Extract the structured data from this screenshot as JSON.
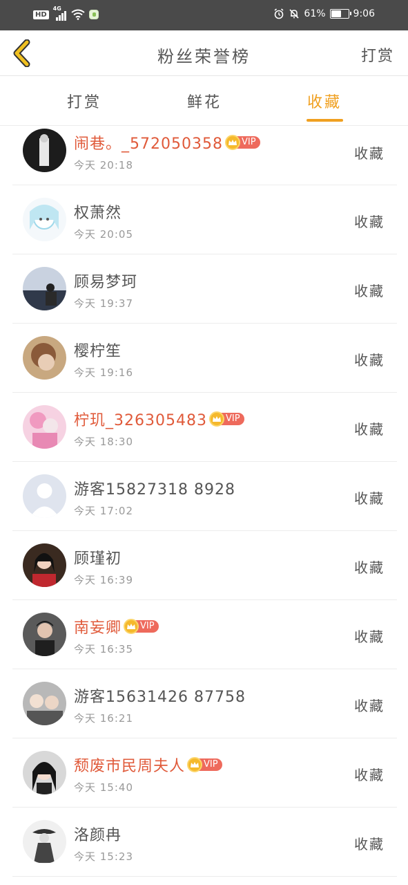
{
  "status_bar": {
    "hd": "HD",
    "network": "4G",
    "battery_text": "61%",
    "battery_level": 0.61,
    "clock": "9:06"
  },
  "header": {
    "title": "粉丝荣誉榜",
    "action": "打赏",
    "back_icon": "chevron-left-icon",
    "accent_color": "#f0c020"
  },
  "tabs": [
    {
      "label": "打赏",
      "active": false
    },
    {
      "label": "鲜花",
      "active": false
    },
    {
      "label": "收藏",
      "active": true
    }
  ],
  "colors": {
    "accent": "#f0a020",
    "vip_name": "#e05a3a",
    "vip_badge": "#ee6a5c"
  },
  "vip_label": "VIP",
  "fans": [
    {
      "name": "闹巷。_572050358",
      "vip": true,
      "time": "今天 20:18",
      "action": "收藏"
    },
    {
      "name": "权萧然",
      "vip": false,
      "time": "今天 20:05",
      "action": "收藏"
    },
    {
      "name": "顾易梦珂",
      "vip": false,
      "time": "今天 19:37",
      "action": "收藏"
    },
    {
      "name": "樱柠笙",
      "vip": false,
      "time": "今天 19:16",
      "action": "收藏"
    },
    {
      "name": "柠玑_326305483",
      "vip": true,
      "time": "今天 18:30",
      "action": "收藏"
    },
    {
      "name": "游客15827318 8928",
      "vip": false,
      "time": "今天 17:02",
      "action": "收藏"
    },
    {
      "name": "顾瑾初",
      "vip": false,
      "time": "今天 16:39",
      "action": "收藏"
    },
    {
      "name": "南妄卿",
      "vip": true,
      "time": "今天 16:35",
      "action": "收藏"
    },
    {
      "name": "游客15631426 87758",
      "vip": false,
      "time": "今天 16:21",
      "action": "收藏"
    },
    {
      "name": "颓废市民周夫人",
      "vip": true,
      "time": "今天 15:40",
      "action": "收藏"
    },
    {
      "name": "洛颜冉",
      "vip": false,
      "time": "今天 15:23",
      "action": "收藏"
    }
  ]
}
